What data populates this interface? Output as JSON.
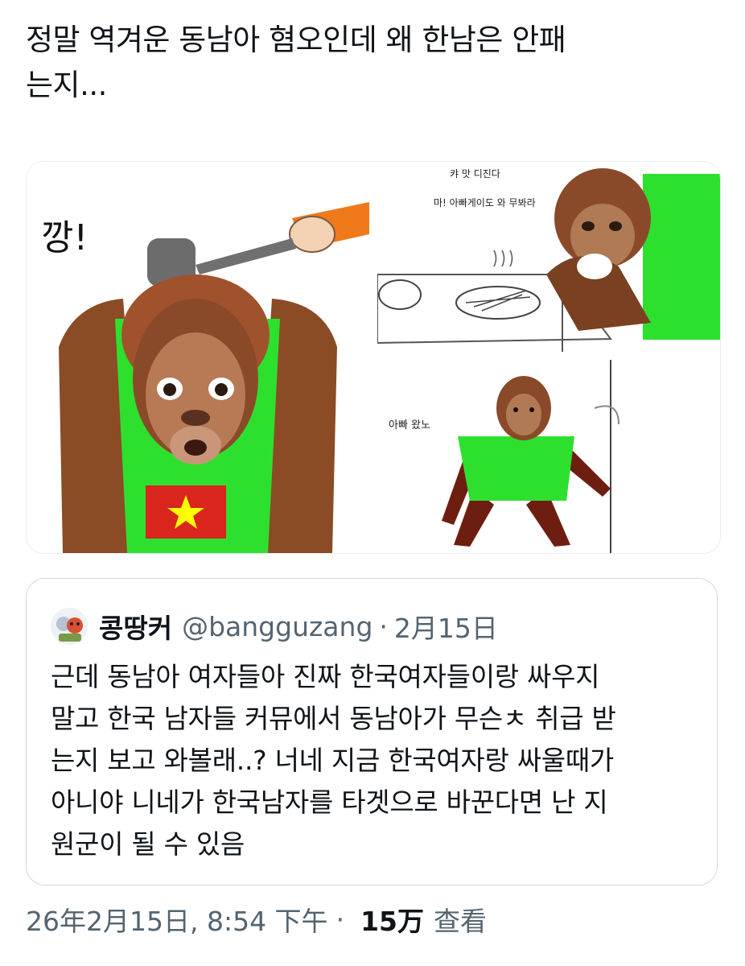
{
  "tweet": {
    "text_line1": "정말 역겨운 동남아 혐오인데 왜 한남은 안패",
    "text_line2": "는지..."
  },
  "media": {
    "panel_left": {
      "caption": "깡!"
    },
    "panel_top_right": {
      "line1": "캬 맛 디진다",
      "line2": "마! 아빠게이도 와 무봐라"
    },
    "panel_bottom_right": {
      "caption": "아빠 왔노"
    }
  },
  "quote": {
    "name": "콩땅커",
    "handle": "@bangguzang",
    "separator": "·",
    "date": "2月15日",
    "lines": [
      "근데 동남아 여자들아 진짜 한국여자들이랑 싸우지",
      "말고 한국 남자들 커뮤에서 동남아가 무슨ㅊ 취급 받",
      "는지 보고 와볼래..? 너네 지금 한국여자랑 싸울때가",
      "아니야 니네가 한국남자를 타겟으로 바꾼다면 난 지",
      "원군이 될 수 있음"
    ]
  },
  "meta": {
    "timestamp": "26年2月15日, 8:54 下午",
    "separator": "·",
    "views_count": "15万",
    "views_label": "查看"
  },
  "colors": {
    "text_primary": "#0f1419",
    "text_secondary": "#536471",
    "border": "#cfd9de",
    "shirt_green": "#2bdc2b",
    "orangutan_brown": "#8a4a2a",
    "flag_red": "#da251d",
    "flag_star": "#ffff00"
  }
}
